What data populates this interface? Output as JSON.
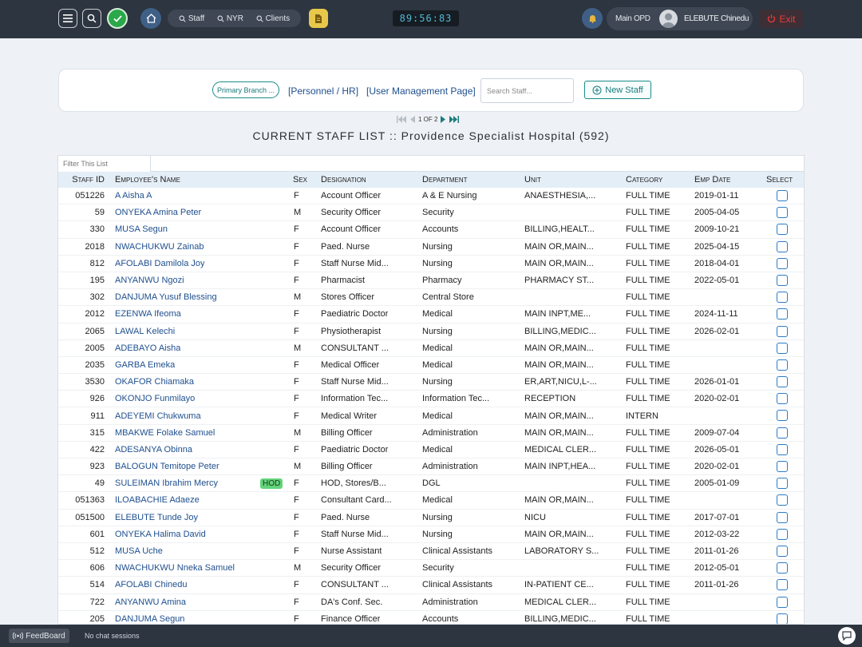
{
  "topbar": {
    "quick_links": [
      "Staff",
      "NYR",
      "Clients"
    ],
    "clock": "89:56:83",
    "location": "Main OPD",
    "user_name": "ELEBUTE Chinedu",
    "exit_label": "Exit"
  },
  "panel": {
    "branch_label": "Primary Branch ...",
    "personnel_link": "[Personnel / HR]",
    "user_mgmt_link": "[User Management Page]",
    "search_placeholder": "Search Staff...",
    "new_staff_label": "New Staff"
  },
  "pager": {
    "text": "1 OF 2"
  },
  "list_title": "CURRENT STAFF LIST :: Providence Specialist Hospital (592)",
  "filter_placeholder": "Filter This List",
  "columns": {
    "id": "Staff ID",
    "name": "Employee's Name",
    "sex": "Sex",
    "designation": "Designation",
    "department": "Department",
    "unit": "Unit",
    "category": "Category",
    "emp_date": "Emp Date",
    "select": "Select"
  },
  "hod_badge": "HOD",
  "rows": [
    {
      "id": "051226",
      "name": "A Aisha A",
      "sex": "F",
      "designation": "Account Officer",
      "department": "A & E Nursing",
      "unit": "ANAESTHESIA,...",
      "category": "FULL TIME",
      "date": "2019-01-11"
    },
    {
      "id": "59",
      "name": "ONYEKA Amina Peter",
      "sex": "M",
      "designation": "Security Officer",
      "department": "Security",
      "unit": "",
      "category": "FULL TIME",
      "date": "2005-04-05"
    },
    {
      "id": "330",
      "name": "MUSA Segun",
      "sex": "F",
      "designation": "Account Officer",
      "department": "Accounts",
      "unit": "BILLING,HEALT...",
      "category": "FULL TIME",
      "date": "2009-10-21"
    },
    {
      "id": "2018",
      "name": "NWACHUKWU Zainab",
      "sex": "F",
      "designation": "Paed. Nurse",
      "department": "Nursing",
      "unit": "MAIN OR,MAIN...",
      "category": "FULL TIME",
      "date": "2025-04-15"
    },
    {
      "id": "812",
      "name": "AFOLABI Damilola Joy",
      "sex": "F",
      "designation": "Staff Nurse Mid...",
      "department": "Nursing",
      "unit": "MAIN OR,MAIN...",
      "category": "FULL TIME",
      "date": "2018-04-01"
    },
    {
      "id": "195",
      "name": "ANYANWU Ngozi",
      "sex": "F",
      "designation": "Pharmacist",
      "department": "Pharmacy",
      "unit": "PHARMACY ST...",
      "category": "FULL TIME",
      "date": "2022-05-01"
    },
    {
      "id": "302",
      "name": "DANJUMA Yusuf Blessing",
      "sex": "M",
      "designation": "Stores Officer",
      "department": "Central Store",
      "unit": "",
      "category": "FULL TIME",
      "date": ""
    },
    {
      "id": "2012",
      "name": "EZENWA Ifeoma",
      "sex": "F",
      "designation": "Paediatric Doctor",
      "department": "Medical",
      "unit": "MAIN INPT,ME...",
      "category": "FULL TIME",
      "date": "2024-11-11"
    },
    {
      "id": "2065",
      "name": "LAWAL Kelechi",
      "sex": "F",
      "designation": "Physiotherapist",
      "department": "Nursing",
      "unit": "BILLING,MEDIC...",
      "category": "FULL TIME",
      "date": "2026-02-01"
    },
    {
      "id": "2005",
      "name": "ADEBAYO Aisha",
      "sex": "M",
      "designation": "CONSULTANT ...",
      "department": "Medical",
      "unit": "MAIN OR,MAIN...",
      "category": "FULL TIME",
      "date": ""
    },
    {
      "id": "2035",
      "name": "GARBA Emeka",
      "sex": "F",
      "designation": "Medical Officer",
      "department": "Medical",
      "unit": "MAIN OR,MAIN...",
      "category": "FULL TIME",
      "date": ""
    },
    {
      "id": "3530",
      "name": "OKAFOR Chiamaka",
      "sex": "F",
      "designation": "Staff Nurse Mid...",
      "department": "Nursing",
      "unit": "ER,ART,NICU,L-...",
      "category": "FULL TIME",
      "date": "2026-01-01"
    },
    {
      "id": "926",
      "name": "OKONJO Funmilayo",
      "sex": "F",
      "designation": "Information Tec...",
      "department": "Information Tec...",
      "unit": "RECEPTION",
      "category": "FULL TIME",
      "date": "2020-02-01"
    },
    {
      "id": "911",
      "name": "ADEYEMI Chukwuma",
      "sex": "F",
      "designation": "Medical Writer",
      "department": "Medical",
      "unit": "MAIN OR,MAIN...",
      "category": "INTERN",
      "date": ""
    },
    {
      "id": "315",
      "name": "MBAKWE Folake Samuel",
      "sex": "M",
      "designation": "Billing Officer",
      "department": "Administration",
      "unit": "MAIN OR,MAIN...",
      "category": "FULL TIME",
      "date": "2009-07-04"
    },
    {
      "id": "422",
      "name": "ADESANYA Obinna",
      "sex": "F",
      "designation": "Paediatric Doctor",
      "department": "Medical",
      "unit": "MEDICAL CLER...",
      "category": "FULL TIME",
      "date": "2026-05-01"
    },
    {
      "id": "923",
      "name": "BALOGUN Temitope Peter",
      "sex": "M",
      "designation": "Billing Officer",
      "department": "Administration",
      "unit": "MAIN INPT,HEA...",
      "category": "FULL TIME",
      "date": "2020-02-01"
    },
    {
      "id": "49",
      "name": "SULEIMAN Ibrahim Mercy",
      "sex": "F",
      "designation": "HOD, Stores/B...",
      "department": "DGL",
      "unit": "",
      "category": "FULL TIME",
      "date": "2005-01-09",
      "hod": true
    },
    {
      "id": "051363",
      "name": "ILOABACHIE Adaeze",
      "sex": "F",
      "designation": "Consultant Card...",
      "department": "Medical",
      "unit": "MAIN OR,MAIN...",
      "category": "FULL TIME",
      "date": ""
    },
    {
      "id": "051500",
      "name": "ELEBUTE Tunde Joy",
      "sex": "F",
      "designation": "Paed. Nurse",
      "department": "Nursing",
      "unit": "NICU",
      "category": "FULL TIME",
      "date": "2017-07-01"
    },
    {
      "id": "601",
      "name": "ONYEKA Halima David",
      "sex": "F",
      "designation": "Staff Nurse Mid...",
      "department": "Nursing",
      "unit": "MAIN OR,MAIN...",
      "category": "FULL TIME",
      "date": "2012-03-22"
    },
    {
      "id": "512",
      "name": "MUSA Uche",
      "sex": "F",
      "designation": "Nurse Assistant",
      "department": "Clinical Assistants",
      "unit": "LABORATORY S...",
      "category": "FULL TIME",
      "date": "2011-01-26"
    },
    {
      "id": "606",
      "name": "NWACHUKWU Nneka Samuel",
      "sex": "M",
      "designation": "Security Officer",
      "department": "Security",
      "unit": "",
      "category": "FULL TIME",
      "date": "2012-05-01"
    },
    {
      "id": "514",
      "name": "AFOLABI Chinedu",
      "sex": "F",
      "designation": "CONSULTANT ...",
      "department": "Clinical Assistants",
      "unit": "IN-PATIENT CE...",
      "category": "FULL TIME",
      "date": "2011-01-26"
    },
    {
      "id": "722",
      "name": "ANYANWU Amina",
      "sex": "F",
      "designation": "DA's Conf. Sec.",
      "department": "Administration",
      "unit": "MEDICAL CLER...",
      "category": "FULL TIME",
      "date": ""
    },
    {
      "id": "205",
      "name": "DANJUMA Segun",
      "sex": "F",
      "designation": "Finance Officer",
      "department": "Accounts",
      "unit": "BILLING,MEDIC...",
      "category": "FULL TIME",
      "date": ""
    }
  ],
  "bottombar": {
    "feedboard_label": "FeedBoard",
    "chat_status": "No chat sessions"
  }
}
